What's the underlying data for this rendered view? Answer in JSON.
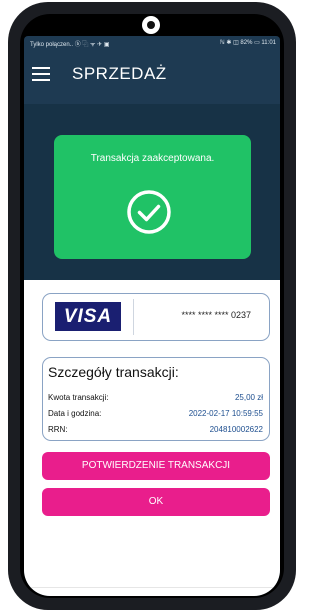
{
  "statusbar": {
    "left": "Tylko połączen.. ⓑ ⿻ ᯤ ✈ ▣",
    "right": "ℕ ✱ ◫ 82% ▭ 11:01"
  },
  "header": {
    "title": "SPRZEDAŻ",
    "menu_icon": "hamburger-menu-icon"
  },
  "status": {
    "message": "Transakcja zaakceptowana.",
    "icon": "check-circle-icon",
    "color": "#20c266"
  },
  "card": {
    "brand": "VISA",
    "masked_number": "**** **** **** 0237"
  },
  "details": {
    "title": "Szczegóły transakcji:",
    "rows": [
      {
        "label": "Kwota transakcji:",
        "value": "25,00 zł"
      },
      {
        "label": "Data i godzina:",
        "value": "2022-02-17 10:59:55"
      },
      {
        "label": "RRN:",
        "value": "204810002622"
      }
    ]
  },
  "buttons": {
    "confirm": "POTWIERDZENIE TRANSAKCJI",
    "ok": "OK",
    "color": "#e91e8c"
  }
}
